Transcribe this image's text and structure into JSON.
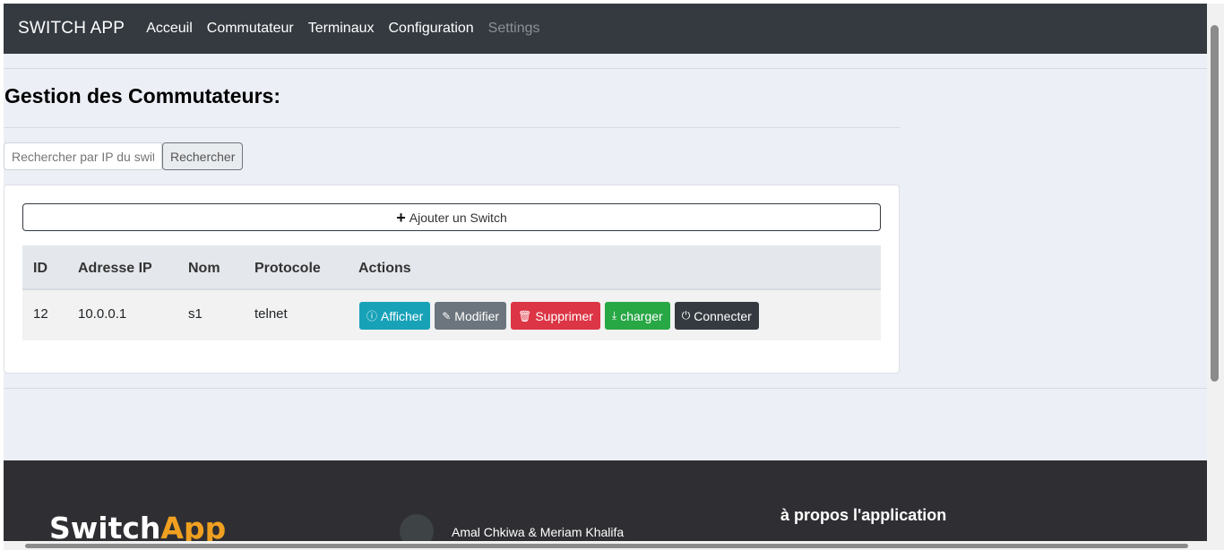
{
  "navbar": {
    "brand": "SWITCH APP",
    "links": [
      "Acceuil",
      "Commutateur",
      "Terminaux",
      "Configuration"
    ],
    "disabled_link": "Settings"
  },
  "page": {
    "title": "Gestion des Commutateurs:"
  },
  "search": {
    "placeholder": "Rechercher par IP du switch",
    "button": "Rechercher"
  },
  "card": {
    "add_button": "Ajouter un Switch"
  },
  "table": {
    "headers": [
      "ID",
      "Adresse IP",
      "Nom",
      "Protocole",
      "Actions"
    ],
    "rows": [
      {
        "id": "12",
        "ip": "10.0.0.1",
        "nom": "s1",
        "protocole": "telnet"
      }
    ],
    "actions": {
      "afficher": "Afficher",
      "modifier": "Modifier",
      "supprimer": "Supprimer",
      "charger": "charger",
      "connecter": "Connecter"
    }
  },
  "footer": {
    "logo_part1": "Switch",
    "logo_part2": "App",
    "authors": "Amal Chkiwa & Meriam Khalifa",
    "about_title": "à propos l'application"
  },
  "colors": {
    "navbar": "#343a40",
    "info": "#17a2b8",
    "secondary": "#6c757d",
    "danger": "#dc3545",
    "success": "#28a745",
    "dark": "#343a40",
    "logo_accent": "#f0a020"
  }
}
